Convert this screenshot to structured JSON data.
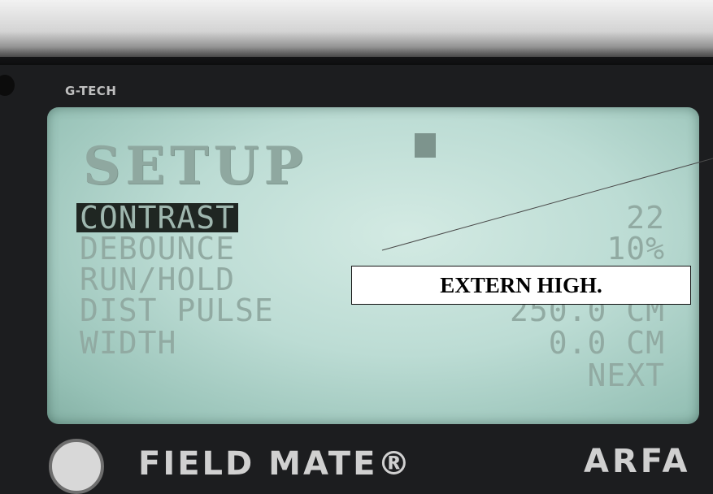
{
  "device": {
    "brand": "G-TECH",
    "bottom_left_text": "FIELD MATE®",
    "bottom_right_text": "ARFA"
  },
  "screen": {
    "title": "SETUP",
    "rows": [
      {
        "label": "CONTRAST",
        "value": "22",
        "selected": true
      },
      {
        "label": "DEBOUNCE",
        "value": "10%",
        "selected": false
      },
      {
        "label": "RUN/HOLD",
        "value": "",
        "selected": false
      },
      {
        "label": "DIST PULSE",
        "value": "250.0 CM",
        "selected": false
      },
      {
        "label": "WIDTH",
        "value": "0.0 CM",
        "selected": false
      },
      {
        "label": "",
        "value": "NEXT",
        "selected": false
      }
    ]
  },
  "annotation": {
    "label": "EXTERN HIGH."
  },
  "colors": {
    "lcd_background": "#c4e1da",
    "lcd_text": "#91aaa2",
    "selection_background": "#1f2622"
  }
}
